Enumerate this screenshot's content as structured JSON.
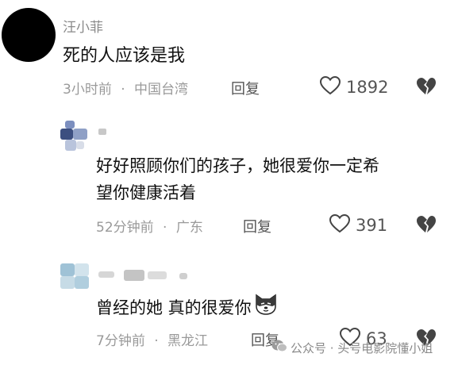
{
  "comments": [
    {
      "username": "汪小菲",
      "text": "死的人应该是我",
      "time": "3小时前",
      "location": "中国台湾",
      "reply_label": "回复",
      "likes": "1892"
    },
    {
      "username": "",
      "text_line1": "好好照顾你们的孩子，她很爱你一定希",
      "text_line2": "望你健康活着",
      "time": "52分钟前",
      "location": "广东",
      "reply_label": "回复",
      "likes": "391"
    },
    {
      "username": "",
      "text": "曾经的她 真的很爱你",
      "time": "7分钟前",
      "location": "黑龙江",
      "reply_label": "回复",
      "likes": "63"
    }
  ],
  "separator": "·",
  "watermark": "公众号 · 头号电影院懂小姐",
  "colors": {
    "avatar1": "#000000",
    "meta": "#9a9a9a",
    "text": "#111111"
  }
}
